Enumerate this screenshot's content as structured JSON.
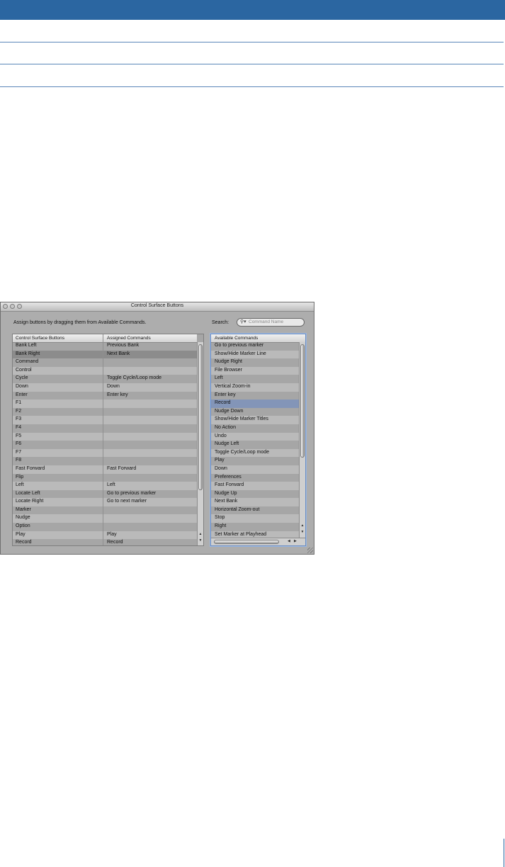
{
  "window": {
    "title": "Control Surface Buttons",
    "instruction": "Assign buttons by dragging them from Available Commands.",
    "search_label": "Search:",
    "search_placeholder": "Command Name"
  },
  "left_table": {
    "columns": [
      "Control Surface Buttons",
      "Assigned Commands"
    ],
    "selected_row": "Bank Right",
    "rows": [
      [
        "Bank Left",
        "Previous Bank"
      ],
      [
        "Bank Right",
        "Next Bank"
      ],
      [
        "Command",
        ""
      ],
      [
        "Control",
        ""
      ],
      [
        "Cycle",
        "Toggle Cycle/Loop mode"
      ],
      [
        "Down",
        "Down"
      ],
      [
        "Enter",
        "Enter key"
      ],
      [
        "F1",
        ""
      ],
      [
        "F2",
        ""
      ],
      [
        "F3",
        ""
      ],
      [
        "F4",
        ""
      ],
      [
        "F5",
        ""
      ],
      [
        "F6",
        ""
      ],
      [
        "F7",
        ""
      ],
      [
        "F8",
        ""
      ],
      [
        "Fast Forward",
        "Fast Forward"
      ],
      [
        "Flip",
        ""
      ],
      [
        "Left",
        "Left"
      ],
      [
        "Locate Left",
        "Go to previous marker"
      ],
      [
        "Locate Right",
        "Go to next marker"
      ],
      [
        "Marker",
        ""
      ],
      [
        "Nudge",
        ""
      ],
      [
        "Option",
        ""
      ],
      [
        "Play",
        "Play"
      ],
      [
        "Record",
        "Record"
      ]
    ]
  },
  "right_table": {
    "column": "Available Commands",
    "selected_row": "Record",
    "rows": [
      "Go to previous marker",
      "Show/Hide Marker Line",
      "Nudge Right",
      "File Browser",
      "Left",
      "Vertical Zoom-in",
      "Enter key",
      "Record",
      "Nudge Down",
      "Show/Hide Marker Titles",
      "No Action",
      "Undo",
      "Nudge Left",
      "Toggle Cycle/Loop mode",
      "Play",
      "Down",
      "Preferences",
      "Fast Forward",
      "Nudge Up",
      "Next Bank",
      "Horizontal Zoom-out",
      "Stop",
      "Right",
      "Set Marker at Playhead"
    ]
  }
}
